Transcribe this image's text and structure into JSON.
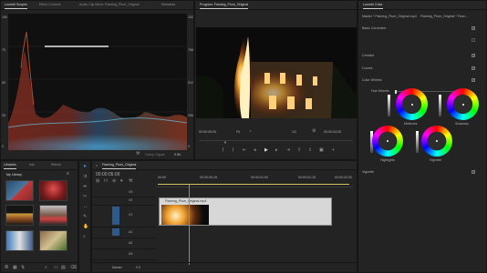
{
  "lumetri_scopes": {
    "tabs": [
      "Lumetri Scopes",
      "Effect Controls",
      "Audio Clip Mixer: Flaming_Plum_Original",
      "Metadata"
    ],
    "scale_left": [
      "100",
      "75",
      "50",
      "25",
      "0"
    ],
    "scale_right": [
      "1023",
      "768",
      "512",
      "256",
      "0"
    ],
    "footer_label": "Clamp Signal",
    "footer_value": "8 Bit"
  },
  "program_monitor": {
    "tab": "Program: Flaming_Plum_Original",
    "timecode_left": "00:00:05:09",
    "zoom": "Fit",
    "resolution": "1/2",
    "timecode_right": "00:00:04:20"
  },
  "lumetri_color": {
    "tab": "Lumetri Color",
    "master_label": "Master * Flaming_Plum_Original.mp4",
    "clip_label": "Flaming_Plum_Original * Flam...",
    "sections": [
      {
        "label": "Basic Correction",
        "checked": true
      },
      {
        "label": "Creative",
        "checked": true
      },
      {
        "label": "Curves",
        "checked": true
      },
      {
        "label": "Color Wheels",
        "checked": true
      }
    ],
    "hsl_label": "Hue Wheels",
    "wheels": [
      "Midtones",
      "Shadows",
      "Highlights",
      "Shadows2"
    ],
    "wheel_labels": [
      "Midtones",
      "Shadows",
      "Highlights",
      "Vignette"
    ],
    "vignette_label": "Vignette",
    "vignette_checked": true
  },
  "libraries": {
    "tabs": [
      "Libraries",
      "Info",
      "Effects"
    ],
    "library_name": "My Library"
  },
  "timeline": {
    "tab": "Flaming_Plum_Original",
    "timecode": "00:00:05:09",
    "ruler": [
      "00:00",
      "00:00:00:15",
      "00:00:01:00",
      "00:00:01:15",
      "00:00:02:00"
    ],
    "tracks": [
      "V3",
      "V2",
      "V1",
      "A1",
      "A2",
      "A3"
    ],
    "clip_name": "Flaming_Plum_Original.mp4",
    "master_label": "Master",
    "master_value": "0.0"
  },
  "colors": {
    "accent": "#3f9ff0",
    "panel": "#232323",
    "clip": "#d7d7d7"
  }
}
